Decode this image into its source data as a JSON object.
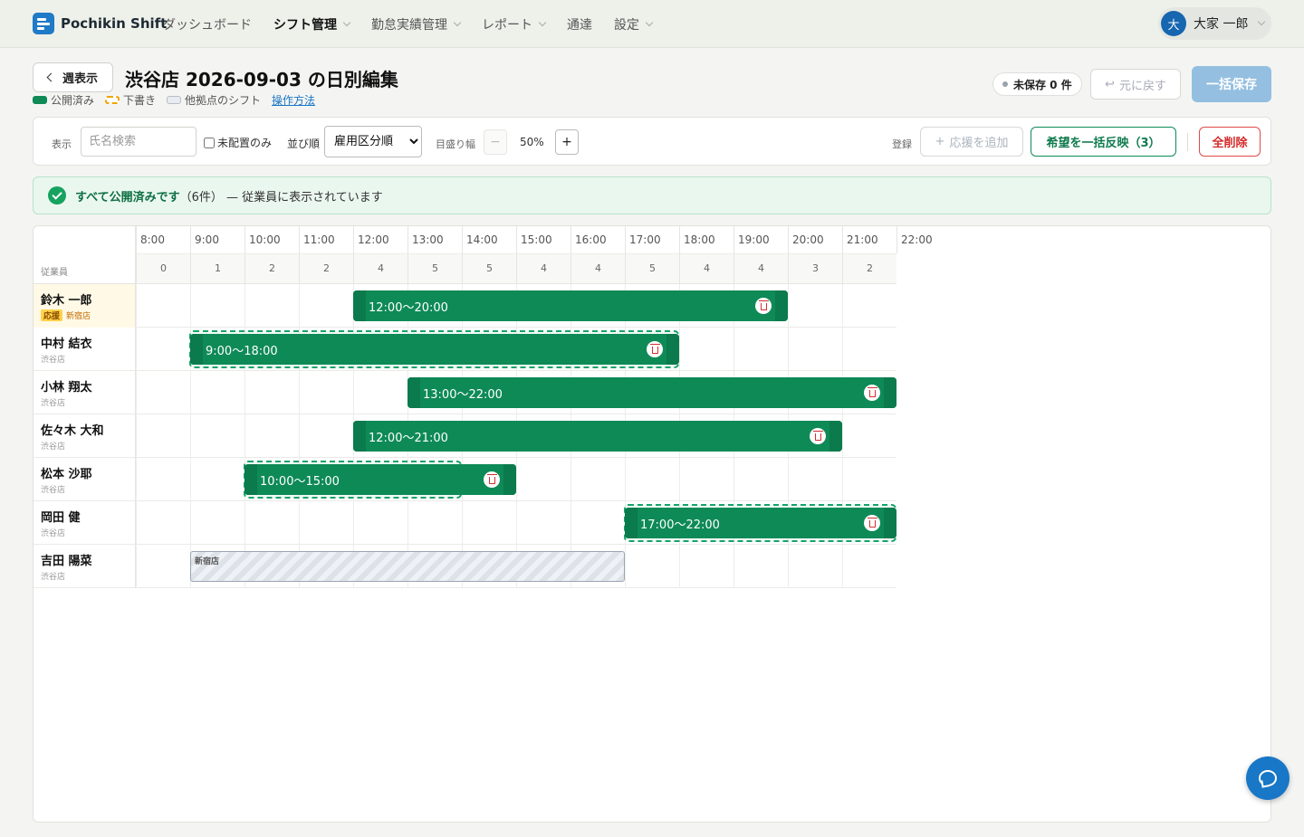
{
  "app": {
    "name": "Pochikin Shift",
    "nav": [
      {
        "label": "ダッシュボード",
        "active": false,
        "dropdown": false
      },
      {
        "label": "シフト管理",
        "active": true,
        "dropdown": true
      },
      {
        "label": "勤怠実績管理",
        "active": false,
        "dropdown": true
      },
      {
        "label": "レポート",
        "active": false,
        "dropdown": true
      },
      {
        "label": "通達",
        "active": false,
        "dropdown": false
      },
      {
        "label": "設定",
        "active": false,
        "dropdown": true
      }
    ],
    "user": {
      "initial": "大",
      "name": "大家 一郎"
    }
  },
  "header": {
    "back_label": "週表示",
    "title": "渋谷店 2026-09-03 の日別編集",
    "legend": {
      "published": "公開済み",
      "draft": "下書き",
      "other_store": "他拠点のシフト",
      "help": "操作方法"
    },
    "unsaved": "未保存 0 件",
    "undo": "元に戻す",
    "save_all": "一括保存"
  },
  "toolbar": {
    "display_label": "表示",
    "search_placeholder": "氏名検索",
    "unassigned_only": "未配置のみ",
    "sort_label": "並び順",
    "sort_value": "雇用区分順",
    "scale_label": "目盛り幅",
    "zoom_minus": "−",
    "zoom_value": "50%",
    "zoom_plus": "+",
    "register_label": "登録",
    "add_support": "応援を追加",
    "apply_hopes": "希望を一括反映（3）",
    "delete_all": "全削除"
  },
  "banner": {
    "strong": "すべて公開済みです",
    "count": "（6件）",
    "message": "— 従業員に表示されています"
  },
  "timeline": {
    "employee_header": "従業員",
    "hours": [
      "8:00",
      "9:00",
      "10:00",
      "11:00",
      "12:00",
      "13:00",
      "14:00",
      "15:00",
      "16:00",
      "17:00",
      "18:00",
      "19:00",
      "20:00",
      "21:00",
      "22:00"
    ],
    "counts": [
      0,
      1,
      2,
      2,
      4,
      5,
      5,
      4,
      4,
      5,
      4,
      4,
      3,
      2
    ],
    "employees": [
      {
        "name": "鈴木 一郎",
        "store": "新宿店",
        "support": true,
        "support_badge": "応援",
        "shift": {
          "start": 12,
          "end": 20,
          "label": "12:00〜20:00"
        },
        "hope": null
      },
      {
        "name": "中村 結衣",
        "store": "渋谷店",
        "support": false,
        "shift": {
          "start": 9,
          "end": 18,
          "label": "9:00〜18:00"
        },
        "hope": {
          "start": 9,
          "end": 18
        }
      },
      {
        "name": "小林 翔太",
        "store": "渋谷店",
        "support": false,
        "shift": {
          "start": 13,
          "end": 22,
          "label": "13:00〜22:00"
        },
        "hope": null
      },
      {
        "name": "佐々木 大和",
        "store": "渋谷店",
        "support": false,
        "shift": {
          "start": 12,
          "end": 21,
          "label": "12:00〜21:00"
        },
        "hope": null
      },
      {
        "name": "松本 沙耶",
        "store": "渋谷店",
        "support": false,
        "shift": {
          "start": 10,
          "end": 15,
          "label": "10:00〜15:00"
        },
        "hope": {
          "start": 10,
          "end": 14
        }
      },
      {
        "name": "岡田 健",
        "store": "渋谷店",
        "support": false,
        "shift": {
          "start": 17,
          "end": 22,
          "label": "17:00〜22:00"
        },
        "hope": {
          "start": 17,
          "end": 22
        }
      },
      {
        "name": "吉田 陽菜",
        "store": "渋谷店",
        "support": false,
        "shift": null,
        "hope": null,
        "other": {
          "start": 9,
          "end": 17,
          "label": "新宿店"
        }
      }
    ]
  },
  "colors": {
    "published": "#0e8a57",
    "draft": "#f0a400",
    "accent": "#1877c6",
    "danger": "#d42a2a"
  }
}
